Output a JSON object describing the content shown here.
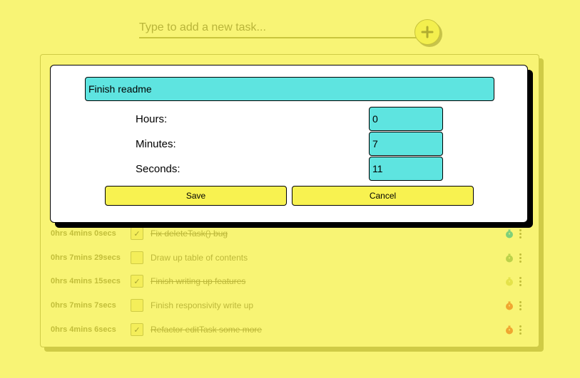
{
  "new_task": {
    "placeholder": "Type to add a new task...",
    "add_icon": "plus-icon"
  },
  "tasks": [
    {
      "time": "0hrs 4mins 0secs",
      "name": "Fix deleteTask() bug",
      "done": true,
      "check": "✓",
      "timer_color": "#7ed07a"
    },
    {
      "time": "0hrs 7mins 29secs",
      "name": "Draw up table of contents",
      "done": false,
      "check": "",
      "timer_color": "#bcd24a"
    },
    {
      "time": "0hrs 4mins 15secs",
      "name": "Finish writing up features",
      "done": true,
      "check": "✓",
      "timer_color": "#e4e24a"
    },
    {
      "time": "0hrs 7mins 7secs",
      "name": "Finish responsivity write up",
      "done": false,
      "check": "",
      "timer_color": "#f0a630"
    },
    {
      "time": "0hrs 4mins 6secs",
      "name": "Refactor editTask some more",
      "done": true,
      "check": "✓",
      "timer_color": "#f0a630"
    }
  ],
  "modal": {
    "title_value": "Finish readme",
    "hours_label": "Hours:",
    "hours_value": "0",
    "minutes_label": "Minutes:",
    "minutes_value": "7",
    "seconds_label": "Seconds:",
    "seconds_value": "11",
    "save_label": "Save",
    "cancel_label": "Cancel"
  }
}
